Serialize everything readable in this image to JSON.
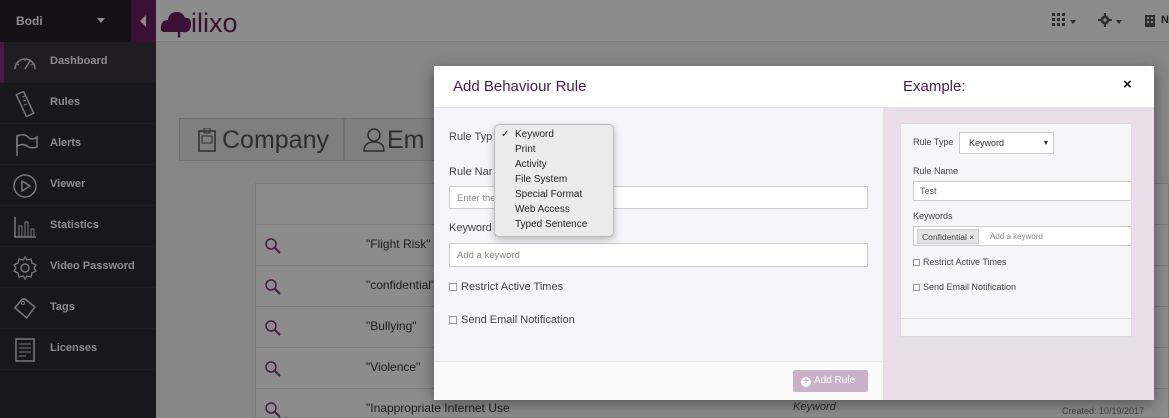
{
  "sidebar": {
    "user_name": "Bodi",
    "items": [
      {
        "label": "Dashboard",
        "icon": "speedometer-icon"
      },
      {
        "label": "Rules",
        "icon": "ruler-icon"
      },
      {
        "label": "Alerts",
        "icon": "flag-icon"
      },
      {
        "label": "Viewer",
        "icon": "play-circle-icon"
      },
      {
        "label": "Statistics",
        "icon": "bar-chart-icon"
      },
      {
        "label": "Video Password",
        "icon": "gear-icon"
      },
      {
        "label": "Tags",
        "icon": "tag-icon"
      },
      {
        "label": "Licenses",
        "icon": "certificate-icon"
      }
    ]
  },
  "topbar": {
    "logo_text": "pilixo",
    "right_initial": "N",
    "icons": [
      "grid-icon",
      "gear-icon",
      "building-icon"
    ]
  },
  "background": {
    "tabs": [
      {
        "label": "Company",
        "icon": "badge-icon"
      },
      {
        "label": "Em",
        "icon": "user-icon"
      }
    ],
    "rows": [
      {
        "name": "\"Flight Risk\"",
        "type": "",
        "created": ""
      },
      {
        "name": "\"confidential\"",
        "type": "",
        "created": ""
      },
      {
        "name": "\"Bullying\"",
        "type": "",
        "created": ""
      },
      {
        "name": "\"Violence\"",
        "type": "",
        "created": ""
      },
      {
        "name": "\"Inappropriate Internet Use",
        "type": "Keyword",
        "created": "Created: 10/19/2017"
      }
    ]
  },
  "modal": {
    "title": "Add Behaviour Rule",
    "rule_type_label": "Rule Typ",
    "rule_name_label": "Rule Nar",
    "rule_name_placeholder": "Enter the",
    "keywords_label": "Keyword",
    "keyword_placeholder": "Add a keyword",
    "restrict_label": "Restrict Active Times",
    "email_label": "Send Email Notification",
    "add_button": "Add Rule",
    "rule_type_options": [
      {
        "label": "Keyword",
        "selected": "✓"
      },
      {
        "label": "Print",
        "selected": ""
      },
      {
        "label": "Activity",
        "selected": ""
      },
      {
        "label": "File System",
        "selected": ""
      },
      {
        "label": "Special Format",
        "selected": ""
      },
      {
        "label": "Web Access",
        "selected": ""
      },
      {
        "label": "Typed Sentence",
        "selected": ""
      }
    ]
  },
  "example": {
    "title": "Example:",
    "close": "×",
    "rule_type_label": "Rule Type",
    "rule_type_value": "Keyword",
    "rule_name_label": "Rule Name",
    "rule_name_value": "Test",
    "keywords_label": "Keywords",
    "tag": "Confidential ×",
    "keyword_placeholder": "Add a keyword",
    "restrict_label": "Restrict Active Times",
    "email_label": "Send Email Notification"
  },
  "colors": {
    "brand": "#6b2060",
    "sidebar_bg": "#2d2a33",
    "modal_title": "#4a1d4e",
    "button_disabled": "#cbb0c9"
  }
}
